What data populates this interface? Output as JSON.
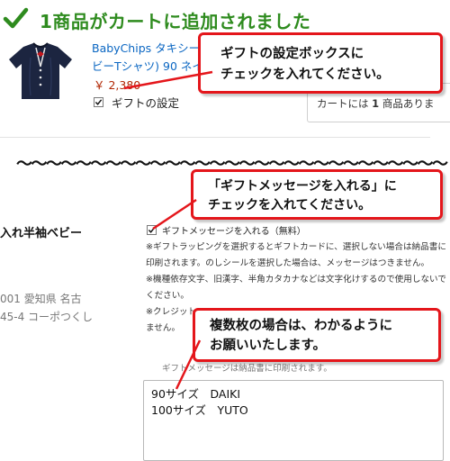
{
  "header": {
    "title": "1商品がカートに追加されました"
  },
  "product": {
    "name_line1": "BabyChips タキシード",
    "name_line2": "ビーTシャツ) 90 ネイビ",
    "price": "￥ 2,380",
    "gift_setting_label": "ギフトの設定",
    "gift_setting_checked": true
  },
  "cart": {
    "prefix": "カートには",
    "count": "1",
    "suffix": "商品ありま"
  },
  "separator": "〜〜〜〜〜〜〜〜〜〜〜〜〜〜〜〜〜〜〜〜〜〜〜〜〜〜〜〜〜",
  "callouts": {
    "c1_line1": "ギフトの設定ボックスに",
    "c1_line2": "チェックを入れてください。",
    "c2_line1": "「ギフトメッセージを入れる」に",
    "c2_line2": "チェックを入れてください。",
    "c3_line1": "複数枚の場合は、わかるように",
    "c3_line2": "お願いいたします。"
  },
  "order_item": {
    "product_partial": "入れ半袖ベビー",
    "address_line1": "001 愛知県 名古",
    "address_line2": "45-4 コーポつくし"
  },
  "gift_message": {
    "checkbox_label": "ギフトメッセージを入れる（無料）",
    "checked": true,
    "notes": [
      "※ギフトラッピングを選択するとギフトカードに、選択しない場合は納品書に印刷されます。のしシールを選択した場合は、メッセージはつきません。",
      "※機種依存文字、旧漢字、半角カタカナなどは文字化けするので使用しないでください。",
      "※クレジット",
      "ません。"
    ],
    "print_note": "ギフトメッセージは納品書に印刷されます。",
    "message_lines": [
      "90サイズ　DAIKI",
      "100サイズ　YUTO"
    ]
  },
  "colors": {
    "accent_green": "#2e8b1e",
    "link_blue": "#0a66c2",
    "price_red": "#b12704",
    "callout_red": "#e4161b"
  }
}
